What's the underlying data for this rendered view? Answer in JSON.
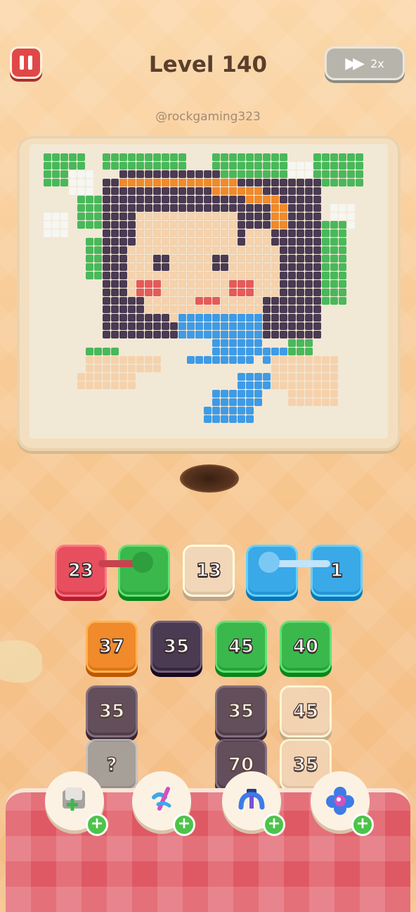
{
  "header": {
    "level_title": "Level 140",
    "speed_label": "2x",
    "pause_icon": "pause-icon",
    "fast_forward_icon": "fast-forward-icon"
  },
  "username": "@rockgaming323",
  "palette": {
    "green": "#49b85a",
    "dark": "#4a3a52",
    "orange": "#f08a2a",
    "skin": "#f5d2ac",
    "blue": "#3e9be6",
    "white": "#f6f6f2",
    "red": "#e55a5a"
  },
  "queue": [
    {
      "value": "23",
      "color": "#e84f5e"
    },
    {
      "value": "",
      "color": "#3bb84c"
    },
    {
      "value": "13",
      "color": "#f2d6b8"
    },
    {
      "value": "",
      "color": "#3aa9e8"
    },
    {
      "value": "1",
      "color": "#3aa9e8"
    }
  ],
  "grid": [
    {
      "value": "37",
      "color": "#f08a2a"
    },
    {
      "value": "35",
      "color": "#4a3a52"
    },
    {
      "value": "45",
      "color": "#3bb84c"
    },
    {
      "value": "40",
      "color": "#3bb84c"
    },
    {
      "value": "35",
      "color": "#4a3a52"
    },
    {
      "value": "35",
      "color": "#4a3a52"
    },
    {
      "value": "45",
      "color": "#f2d6b8"
    },
    {
      "value": "?",
      "color": "#9a9a9a"
    },
    {
      "value": "70",
      "color": "#4a3a52"
    },
    {
      "value": "35",
      "color": "#f2d6b8"
    }
  ],
  "boosters": [
    {
      "icon": "add-slot-icon",
      "plus": "+"
    },
    {
      "icon": "magic-wand-icon",
      "plus": "+"
    },
    {
      "icon": "magnet-claw-icon",
      "plus": "+"
    },
    {
      "icon": "flower-color-icon",
      "plus": "+"
    }
  ]
}
